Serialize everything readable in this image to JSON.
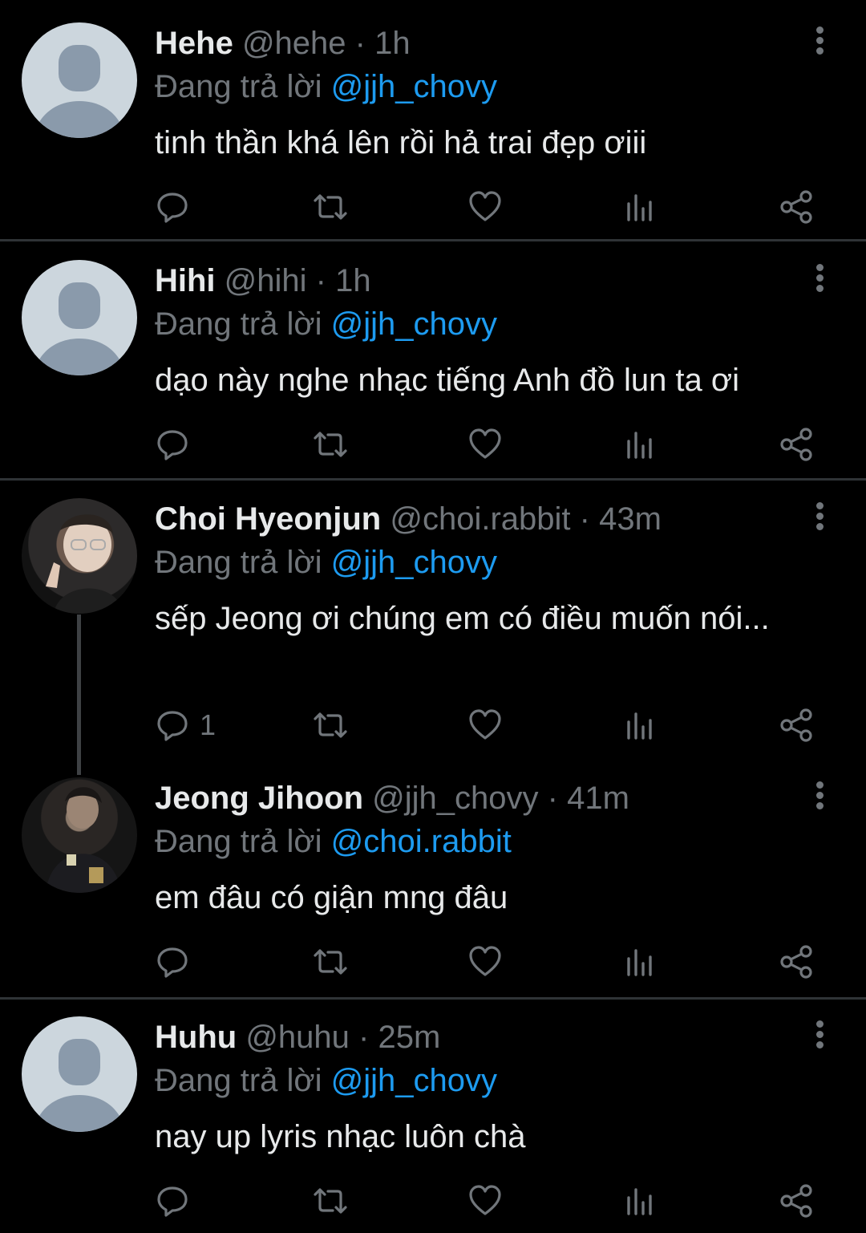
{
  "reply_prefix": "Đang trả lời",
  "tweets": [
    {
      "name": "Hehe",
      "handle": "@hehe",
      "separator": "·",
      "time": "1h",
      "replying_to": "@jjh_chovy",
      "text": "tinh thần khá lên rồi hả trai đẹp ơiii",
      "reply_count": ""
    },
    {
      "name": "Hihi",
      "handle": "@hihi",
      "separator": "·",
      "time": "1h",
      "replying_to": "@jjh_chovy",
      "text": "dạo này nghe nhạc tiếng Anh đồ lun ta ơi",
      "reply_count": ""
    },
    {
      "name": "Choi Hyeonjun",
      "handle": "@choi.rabbit",
      "separator": "·",
      "time": "43m",
      "replying_to": "@jjh_chovy",
      "text": "sếp Jeong ơi chúng em có điều muốn nói...",
      "reply_count": "1"
    },
    {
      "name": "Jeong Jihoon",
      "handle": "@jjh_chovy",
      "separator": "·",
      "time": "41m",
      "replying_to": "@choi.rabbit",
      "text": "em đâu có giận mng đâu",
      "reply_count": ""
    },
    {
      "name": "Huhu",
      "handle": "@huhu",
      "separator": "·",
      "time": "25m",
      "replying_to": "@jjh_chovy",
      "text": "nay up lyris nhạc luôn chà",
      "reply_count": ""
    }
  ],
  "icons": {
    "reply": "reply-icon",
    "retweet": "retweet-icon",
    "like": "heart-icon",
    "views": "analytics-icon",
    "share": "share-icon",
    "more": "more-vertical-icon"
  },
  "colors": {
    "background": "#000000",
    "text": "#e7e9ea",
    "muted": "#71767b",
    "mention": "#1d9bf0",
    "divider": "#2f3336"
  }
}
